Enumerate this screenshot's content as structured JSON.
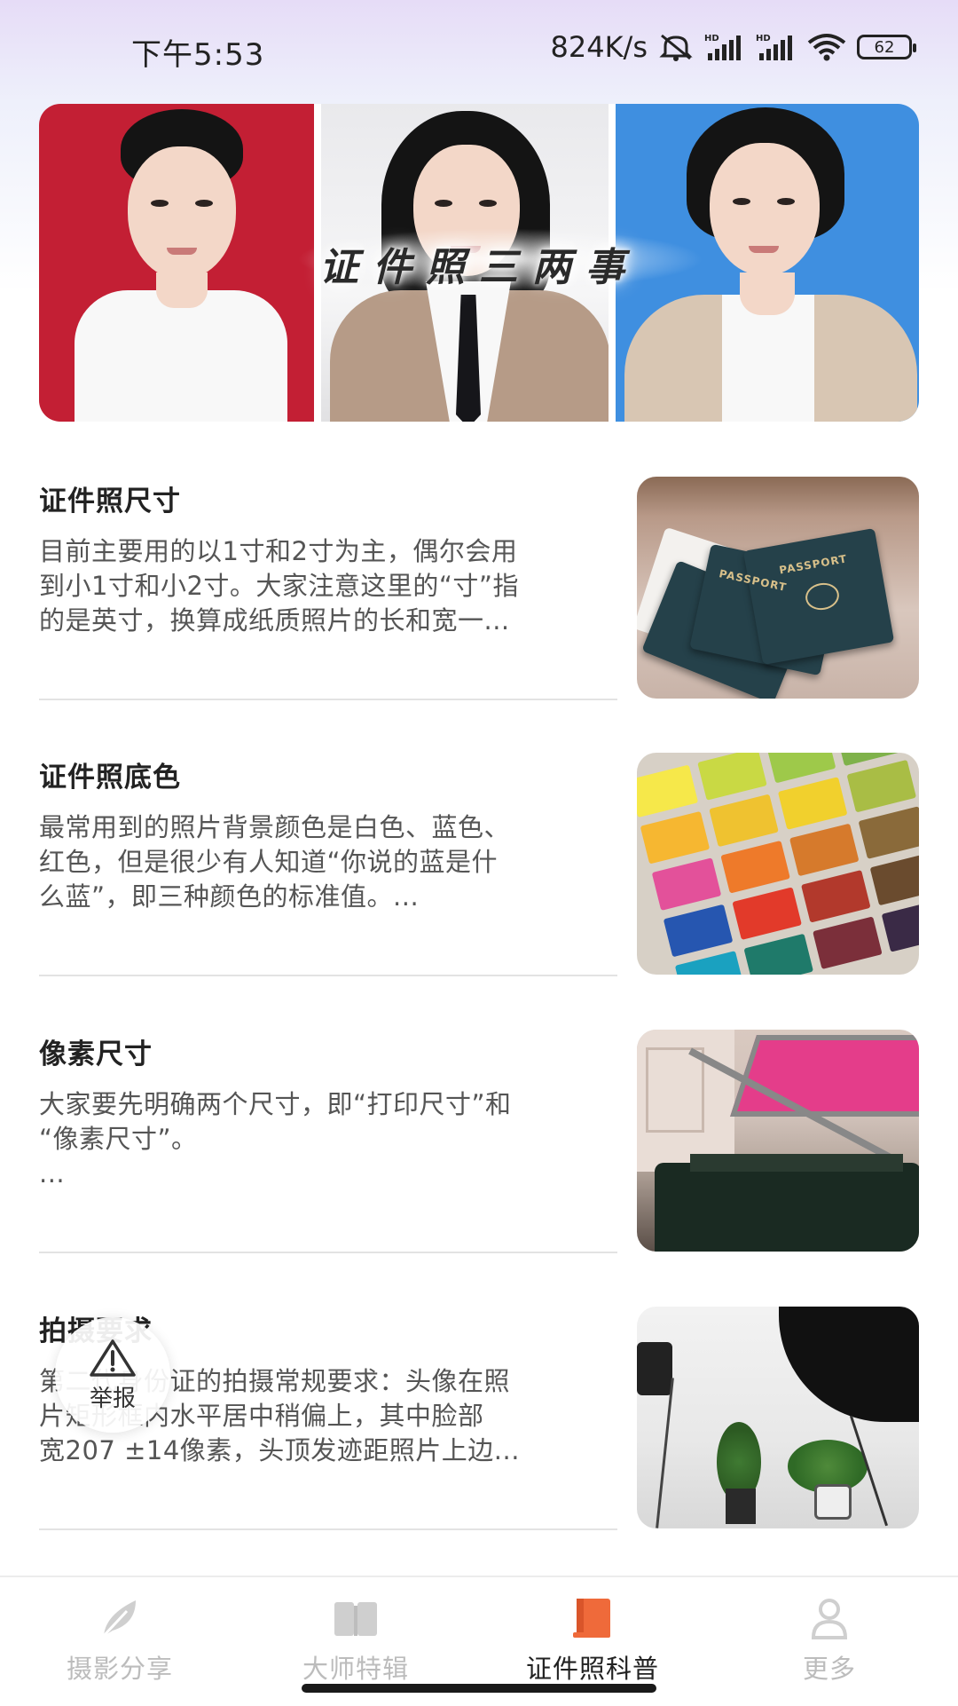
{
  "status_bar": {
    "time": "下午5:53",
    "net_speed": "824K/s",
    "battery": "62",
    "icons": [
      "mute-icon",
      "signal-hd-icon",
      "signal-hd-icon",
      "wifi-icon",
      "battery-icon"
    ]
  },
  "banner": {
    "caption": "证件照三两事"
  },
  "articles": [
    {
      "title": "证件照尺寸",
      "summary": "目前主要用的以1寸和2寸为主，偶尔会用\n到小1寸和小2寸。大家注意这里的“寸”指\n的是英寸，换算成纸质照片的长和宽一...",
      "image": "passport-photo"
    },
    {
      "title": "证件照底色",
      "summary": "最常用到的照片背景颜色是白色、蓝色、\n红色，但是很少有人知道“你说的蓝是什\n么蓝”，即三种颜色的标准值。...",
      "image": "color-swatches-photo"
    },
    {
      "title": "像素尺寸",
      "summary": "大家要先明确两个尺寸，即“打印尺寸”和\n“像素尺寸”。\n...",
      "image": "printer-photo"
    },
    {
      "title": "拍摄要求",
      "summary": "第二代身份证的拍摄常规要求：头像在照\n片矩形框内水平居中稍偏上，其中脸部\n宽207 ±14像素，头顶发迹距照片上边...",
      "image": "studio-photo"
    }
  ],
  "report_button": {
    "label": "举报",
    "icon": "warning-icon"
  },
  "bottom_nav": {
    "items": [
      {
        "label": "摄影分享",
        "icon": "feather-icon",
        "active": false
      },
      {
        "label": "大师特辑",
        "icon": "book-icon",
        "active": false
      },
      {
        "label": "证件照科普",
        "icon": "notebook-icon",
        "active": true
      },
      {
        "label": "更多",
        "icon": "person-icon",
        "active": false
      }
    ]
  },
  "colors": {
    "accent": "#ef6a3a",
    "inactive": "#bcbcbc",
    "text_primary": "#222222",
    "text_secondary": "#555555"
  }
}
